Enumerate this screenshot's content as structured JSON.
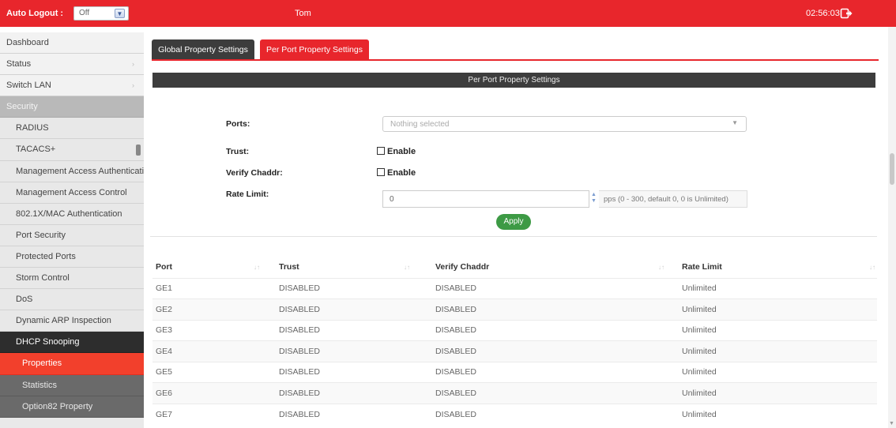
{
  "topbar": {
    "autologout_label": "Auto Logout :",
    "autologout_value": "Off",
    "user": "Tom",
    "clock": "02:56:03",
    "logout_icon": "logout-icon",
    "bg_color": "#e8262c"
  },
  "sidebar": {
    "items": [
      {
        "label": "Dashboard"
      },
      {
        "label": "Status"
      },
      {
        "label": "Switch LAN"
      },
      {
        "label": "Security"
      },
      {
        "label": "RADIUS"
      },
      {
        "label": "TACACS+"
      },
      {
        "label": "Management Access Authentication"
      },
      {
        "label": "Management Access Control"
      },
      {
        "label": "802.1X/MAC Authentication"
      },
      {
        "label": "Port Security"
      },
      {
        "label": "Protected Ports"
      },
      {
        "label": "Storm Control"
      },
      {
        "label": "DoS"
      },
      {
        "label": "Dynamic ARP Inspection"
      },
      {
        "label": "DHCP Snooping"
      },
      {
        "label": "Properties"
      },
      {
        "label": "Statistics"
      },
      {
        "label": "Option82 Property"
      }
    ]
  },
  "tabs": [
    {
      "label": "Global Property Settings",
      "active": false
    },
    {
      "label": "Per Port Property Settings",
      "active": true
    }
  ],
  "section_title": "Per Port Property Settings",
  "form": {
    "ports_label": "Ports:",
    "ports_placeholder": "Nothing selected",
    "trust_label": "Trust:",
    "trust_option": "Enable",
    "verify_label": "Verify Chaddr:",
    "verify_option": "Enable",
    "rate_label": "Rate Limit:",
    "rate_value": "0",
    "rate_hint": "pps (0 - 300, default 0, 0 is Unlimited)",
    "apply_label": "Apply"
  },
  "table": {
    "headers": [
      "Port",
      "Trust",
      "Verify Chaddr",
      "Rate Limit"
    ],
    "rows": [
      [
        "GE1",
        "DISABLED",
        "DISABLED",
        "Unlimited"
      ],
      [
        "GE2",
        "DISABLED",
        "DISABLED",
        "Unlimited"
      ],
      [
        "GE3",
        "DISABLED",
        "DISABLED",
        "Unlimited"
      ],
      [
        "GE4",
        "DISABLED",
        "DISABLED",
        "Unlimited"
      ],
      [
        "GE5",
        "DISABLED",
        "DISABLED",
        "Unlimited"
      ],
      [
        "GE6",
        "DISABLED",
        "DISABLED",
        "Unlimited"
      ],
      [
        "GE7",
        "DISABLED",
        "DISABLED",
        "Unlimited"
      ]
    ]
  },
  "colors": {
    "accent_red": "#e8262c",
    "apply_green": "#3d9a45",
    "dark_bar": "#3d3d3d"
  }
}
